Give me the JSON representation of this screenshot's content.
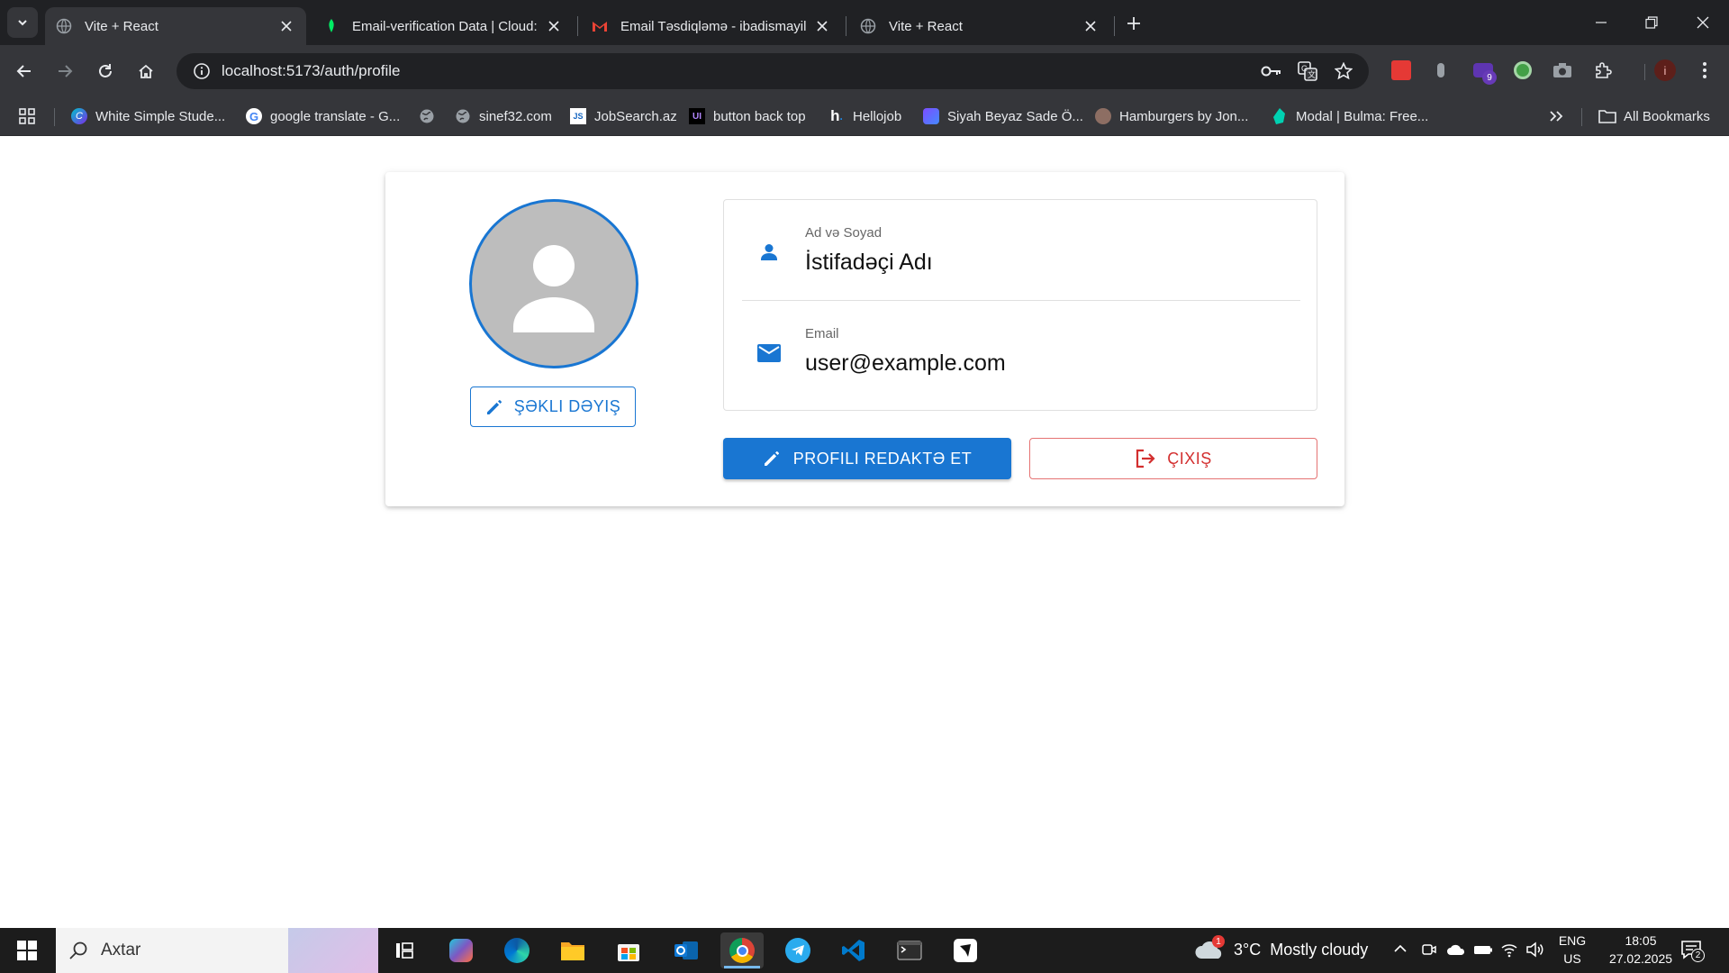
{
  "browser": {
    "tabs": [
      {
        "title": "Vite + React",
        "active": true,
        "icon": "globe-icon"
      },
      {
        "title": "Email-verification Data | Cloud:",
        "active": false,
        "icon": "mongodb-leaf-icon"
      },
      {
        "title": "Email Təsdiqləmə - ibadismayilo",
        "active": false,
        "icon": "gmail-icon"
      },
      {
        "title": "Vite + React",
        "active": false,
        "icon": "globe-icon"
      }
    ],
    "url": "localhost:5173/auth/profile",
    "bookmarks": [
      {
        "label": "White Simple Stude...",
        "icon": "canva-icon"
      },
      {
        "label": "google translate - G...",
        "icon": "google-icon"
      },
      {
        "label": "",
        "icon": "globe-icon"
      },
      {
        "label": "sinef32.com",
        "icon": "globe-icon"
      },
      {
        "label": "JobSearch.az",
        "icon": "jobsearch-icon"
      },
      {
        "label": "button back top",
        "icon": "uiverse-icon"
      },
      {
        "label": "Hellojob",
        "icon": "hellojob-icon"
      },
      {
        "label": "Siyah Beyaz Sade Ö...",
        "icon": "canva-doc-icon"
      },
      {
        "label": "Hamburgers by Jon...",
        "icon": "hamburger-icon"
      },
      {
        "label": "Modal | Bulma: Free...",
        "icon": "bulma-icon"
      }
    ],
    "all_bookmarks": "All Bookmarks",
    "extension_badge": "9"
  },
  "profile": {
    "change_photo_label": "ŞƏKLI DƏYIŞ",
    "name_label": "Ad və Soyad",
    "name_value": "İstifadəçi Adı",
    "email_label": "Email",
    "email_value": "user@example.com",
    "edit_label": "PROFILI REDAKTƏ ET",
    "logout_label": "ÇIXIŞ"
  },
  "taskbar": {
    "search_placeholder": "Axtar",
    "weather": "3°C  Mostly cloudy",
    "weather_badge": "1",
    "lang_top": "ENG",
    "lang_bottom": "US",
    "time": "18:05",
    "date": "27.02.2025",
    "notification_count": "2"
  },
  "colors": {
    "primary": "#1976d2",
    "danger": "#d32f2f",
    "chrome_dark": "#202124",
    "chrome_toolbar": "#35363a"
  }
}
